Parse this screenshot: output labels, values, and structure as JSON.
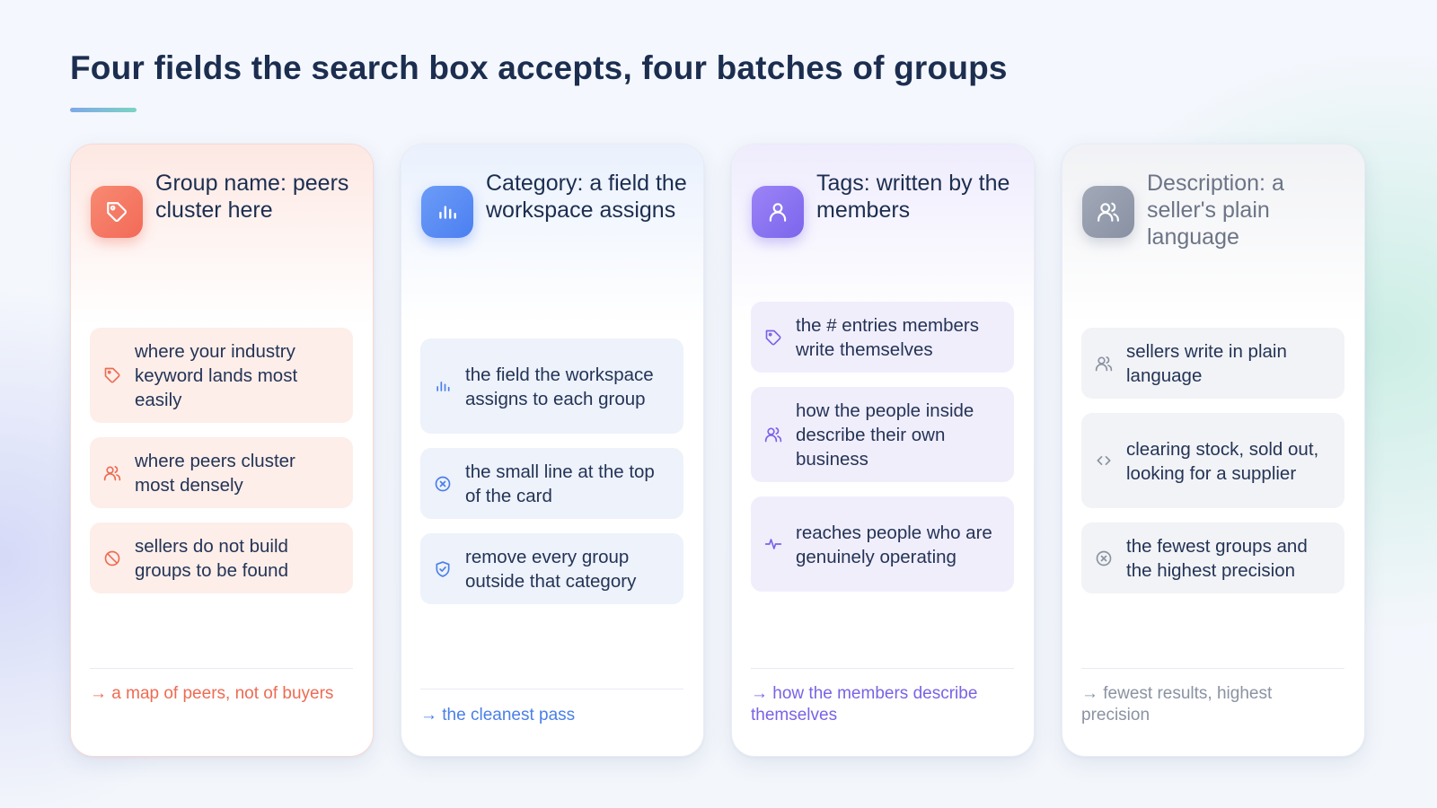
{
  "page": {
    "title": "Four fields the search box accepts, four batches of groups"
  },
  "cards": [
    {
      "title": "Group name: peers cluster here",
      "icon": "tag-icon",
      "accent": "#f26a58",
      "items": [
        {
          "text": "where your industry keyword lands most easily",
          "icon": "tag-icon"
        },
        {
          "text": "where peers cluster most densely",
          "icon": "users-icon"
        },
        {
          "text": "sellers do not build groups to be found",
          "icon": "ban-icon"
        }
      ],
      "footer": "→ a map of peers, not of buyers"
    },
    {
      "title": "Category: a field the workspace assigns",
      "icon": "bar-chart-icon",
      "accent": "#4b7ff1",
      "items": [
        {
          "text": "the field the workspace assigns to each group",
          "icon": "bar-chart-icon"
        },
        {
          "text": "the small line at the top of the card",
          "icon": "x-circle-icon"
        },
        {
          "text": "remove every group outside that category",
          "icon": "shield-check-icon"
        }
      ],
      "footer": "→ the cleanest pass"
    },
    {
      "title": "Tags: written by the members",
      "icon": "user-icon",
      "accent": "#7c65ec",
      "items": [
        {
          "text": "the # entries members write themselves",
          "icon": "tag-icon"
        },
        {
          "text": "how the people inside describe their own business",
          "icon": "users-icon"
        },
        {
          "text": "reaches people who are genuinely operating",
          "icon": "pulse-icon"
        }
      ],
      "footer": "→ how the members describe themselves"
    },
    {
      "title": "Description: a seller's plain language",
      "icon": "users-icon",
      "accent": "#8891a3",
      "items": [
        {
          "text": "sellers write in plain language",
          "icon": "users-icon"
        },
        {
          "text": "clearing stock, sold out, looking for a supplier",
          "icon": "code-icon"
        },
        {
          "text": "the fewest groups and the highest precision",
          "icon": "x-circle-icon"
        }
      ],
      "footer": "→ fewest results, highest precision"
    }
  ]
}
